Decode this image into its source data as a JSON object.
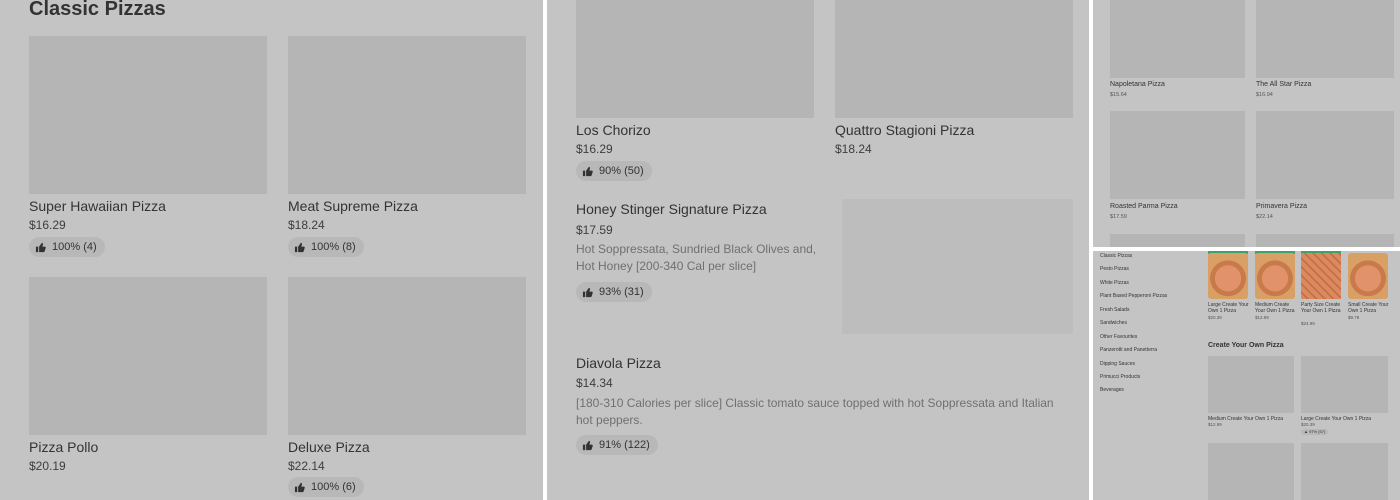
{
  "panel1": {
    "heading": "Classic Pizzas",
    "items": [
      {
        "name": "Super Hawaiian Pizza",
        "price": "$16.29",
        "rating": "100% (4)"
      },
      {
        "name": "Meat Supreme Pizza",
        "price": "$18.24",
        "rating": "100% (8)"
      },
      {
        "name": "Pizza Pollo",
        "price": "$20.19"
      },
      {
        "name": "Deluxe Pizza",
        "price": "$22.14",
        "rating": "100% (6)"
      }
    ]
  },
  "panel2": {
    "items": [
      {
        "name": "Los Chorizo",
        "price": "$16.29",
        "rating": "90% (50)"
      },
      {
        "name": "Quattro Stagioni Pizza",
        "price": "$18.24"
      },
      {
        "name": "Honey Stinger Signature Pizza",
        "price": "$17.59",
        "description": "Hot Soppressata, Sundried Black Olives and, Hot Honey [200-340 Cal per slice]",
        "rating": "93% (31)"
      },
      {
        "name": "Diavola Pizza",
        "price": "$14.34",
        "description": "[180-310 Calories per slice] Classic tomato sauce topped with hot Soppressata and Italian hot peppers.",
        "rating": "91% (122)"
      }
    ]
  },
  "panel3": {
    "items": [
      {
        "name": "Napoletana Pizza",
        "price": "$15.64"
      },
      {
        "name": "The All Star Pizza",
        "price": "$16.94"
      },
      {
        "name": "Roasted Parma Pizza",
        "price": "$17.59"
      },
      {
        "name": "Primavera Pizza",
        "price": "$22.14"
      }
    ]
  },
  "panel4": {
    "nav": [
      "Classic Pizzas",
      "Pesto Pizzas",
      "White Pizzas",
      "Plant Based Pepperoni Pizzas",
      "Fresh Salads",
      "Sandwiches",
      "Other Favourites",
      "Panzerotti and Panetterra",
      "Dipping Sauces",
      "Primucci Products",
      "Beverages"
    ],
    "top_items": [
      {
        "name": "Large Create Your Own 1 Pizza",
        "price": "$20.39"
      },
      {
        "name": "Medium Create Your Own 1 Pizza",
        "price": "$12.99"
      },
      {
        "name": "Party Size Create Your Own 1 Pizza",
        "price": "$24.99"
      },
      {
        "name": "Small Create Your Own 1 Pizza",
        "price": "$9.79"
      }
    ],
    "section_heading": "Create Your Own Pizza",
    "items": [
      {
        "name": "Medium Create Your Own 1 Pizza",
        "price": "$12.99"
      },
      {
        "name": "Large Create Your Own 1 Pizza",
        "price": "$20.39",
        "rating": "97% (57)"
      }
    ]
  },
  "colors": {
    "overlay_bg": "#c4c4c4",
    "placeholder": "#b5b5b5",
    "badge": "#b8b8b8",
    "accent": "#3fa26b"
  },
  "icons": {
    "rating": "thumbs-up-icon"
  }
}
